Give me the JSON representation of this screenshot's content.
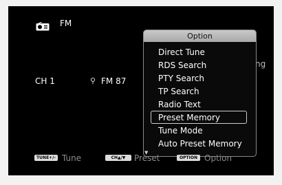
{
  "source": {
    "icon": "radio-icon",
    "label": "FM"
  },
  "channel": {
    "label": "CH 1",
    "signal_icon": "signal-icon",
    "signal_glyph": "⚲",
    "frequency": "FM 87"
  },
  "background_trailing_text": "ng",
  "popup": {
    "title": "Option",
    "items": [
      {
        "label": "Direct Tune",
        "selected": false
      },
      {
        "label": "RDS Search",
        "selected": false
      },
      {
        "label": "PTY Search",
        "selected": false
      },
      {
        "label": "TP Search",
        "selected": false
      },
      {
        "label": "Radio Text",
        "selected": false
      },
      {
        "label": "Preset Memory",
        "selected": true
      },
      {
        "label": "Tune Mode",
        "selected": false
      },
      {
        "label": "Auto Preset Memory",
        "selected": false
      }
    ],
    "scroll_glyph": "▼"
  },
  "hints": {
    "tune": {
      "key": "TUNE+/-",
      "text": "Tune"
    },
    "preset": {
      "key": "CH▲/▼",
      "text": "Preset"
    },
    "option": {
      "key": "OPTION",
      "text": "Option"
    }
  },
  "colors": {
    "screen_bg": "#000000",
    "popup_header": "#b9b9b9",
    "hint_text": "#8c8c8c"
  }
}
